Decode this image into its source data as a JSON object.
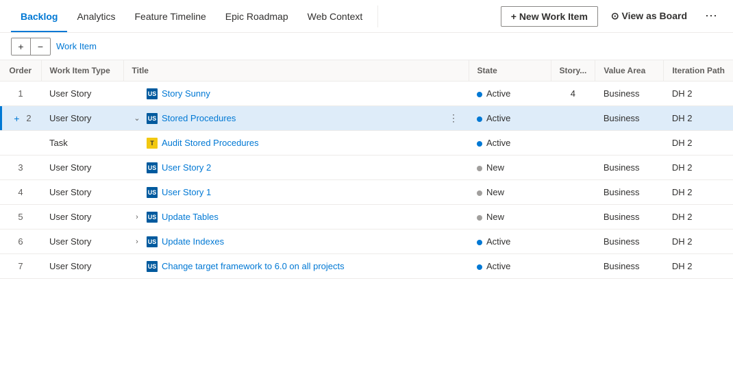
{
  "nav": {
    "items": [
      {
        "label": "Backlog",
        "active": true
      },
      {
        "label": "Analytics",
        "active": false
      },
      {
        "label": "Feature Timeline",
        "active": false
      },
      {
        "label": "Epic Roadmap",
        "active": false
      },
      {
        "label": "Web Context",
        "active": false
      }
    ],
    "new_item_label": "+ New Work Item",
    "view_board_label": "⊙ View as Board",
    "more_icon": "⋯"
  },
  "toolbar": {
    "add_icon": "+",
    "remove_icon": "−",
    "breadcrumb": [
      {
        "label": "Work Item",
        "link": true
      },
      {
        "sep": "/"
      }
    ]
  },
  "table": {
    "columns": [
      "Order",
      "Work Item Type",
      "Title",
      "State",
      "Story...",
      "Value Area",
      "Iteration Path"
    ],
    "rows": [
      {
        "order": "1",
        "type": "User Story",
        "typeIcon": "US",
        "typeClass": "icon-user-story",
        "title": "Story Sunny",
        "expandable": false,
        "state": "Active",
        "stateDot": "dot-active",
        "story": "4",
        "valueArea": "Business",
        "iteration": "DH 2",
        "highlighted": false,
        "isChild": false
      },
      {
        "order": "2",
        "type": "User Story",
        "typeIcon": "US",
        "typeClass": "icon-user-story",
        "title": "Stored Procedures",
        "expandable": true,
        "expanded": true,
        "state": "Active",
        "stateDot": "dot-active",
        "story": "",
        "valueArea": "Business",
        "iteration": "DH 2",
        "highlighted": true,
        "isChild": false,
        "showActions": true
      },
      {
        "order": "",
        "type": "Task",
        "typeIcon": "T",
        "typeClass": "icon-task",
        "title": "Audit Stored Procedures",
        "expandable": false,
        "state": "Active",
        "stateDot": "dot-active",
        "story": "",
        "valueArea": "",
        "iteration": "DH 2",
        "highlighted": false,
        "isChild": true
      },
      {
        "order": "3",
        "type": "User Story",
        "typeIcon": "US",
        "typeClass": "icon-user-story",
        "title": "User Story 2",
        "expandable": false,
        "state": "New",
        "stateDot": "dot-new",
        "story": "",
        "valueArea": "Business",
        "iteration": "DH 2",
        "highlighted": false,
        "isChild": false
      },
      {
        "order": "4",
        "type": "User Story",
        "typeIcon": "US",
        "typeClass": "icon-user-story",
        "title": "User Story 1",
        "expandable": false,
        "state": "New",
        "stateDot": "dot-new",
        "story": "",
        "valueArea": "Business",
        "iteration": "DH 2",
        "highlighted": false,
        "isChild": false
      },
      {
        "order": "5",
        "type": "User Story",
        "typeIcon": "US",
        "typeClass": "icon-user-story",
        "title": "Update Tables",
        "expandable": true,
        "expanded": false,
        "state": "New",
        "stateDot": "dot-new",
        "story": "",
        "valueArea": "Business",
        "iteration": "DH 2",
        "highlighted": false,
        "isChild": false
      },
      {
        "order": "6",
        "type": "User Story",
        "typeIcon": "US",
        "typeClass": "icon-user-story",
        "title": "Update Indexes",
        "expandable": true,
        "expanded": false,
        "state": "Active",
        "stateDot": "dot-active",
        "story": "",
        "valueArea": "Business",
        "iteration": "DH 2",
        "highlighted": false,
        "isChild": false
      },
      {
        "order": "7",
        "type": "User Story",
        "typeIcon": "US",
        "typeClass": "icon-user-story",
        "title": "Change target framework to 6.0 on all projects",
        "expandable": false,
        "state": "Active",
        "stateDot": "dot-active",
        "story": "",
        "valueArea": "Business",
        "iteration": "DH 2",
        "highlighted": false,
        "isChild": false
      }
    ]
  }
}
